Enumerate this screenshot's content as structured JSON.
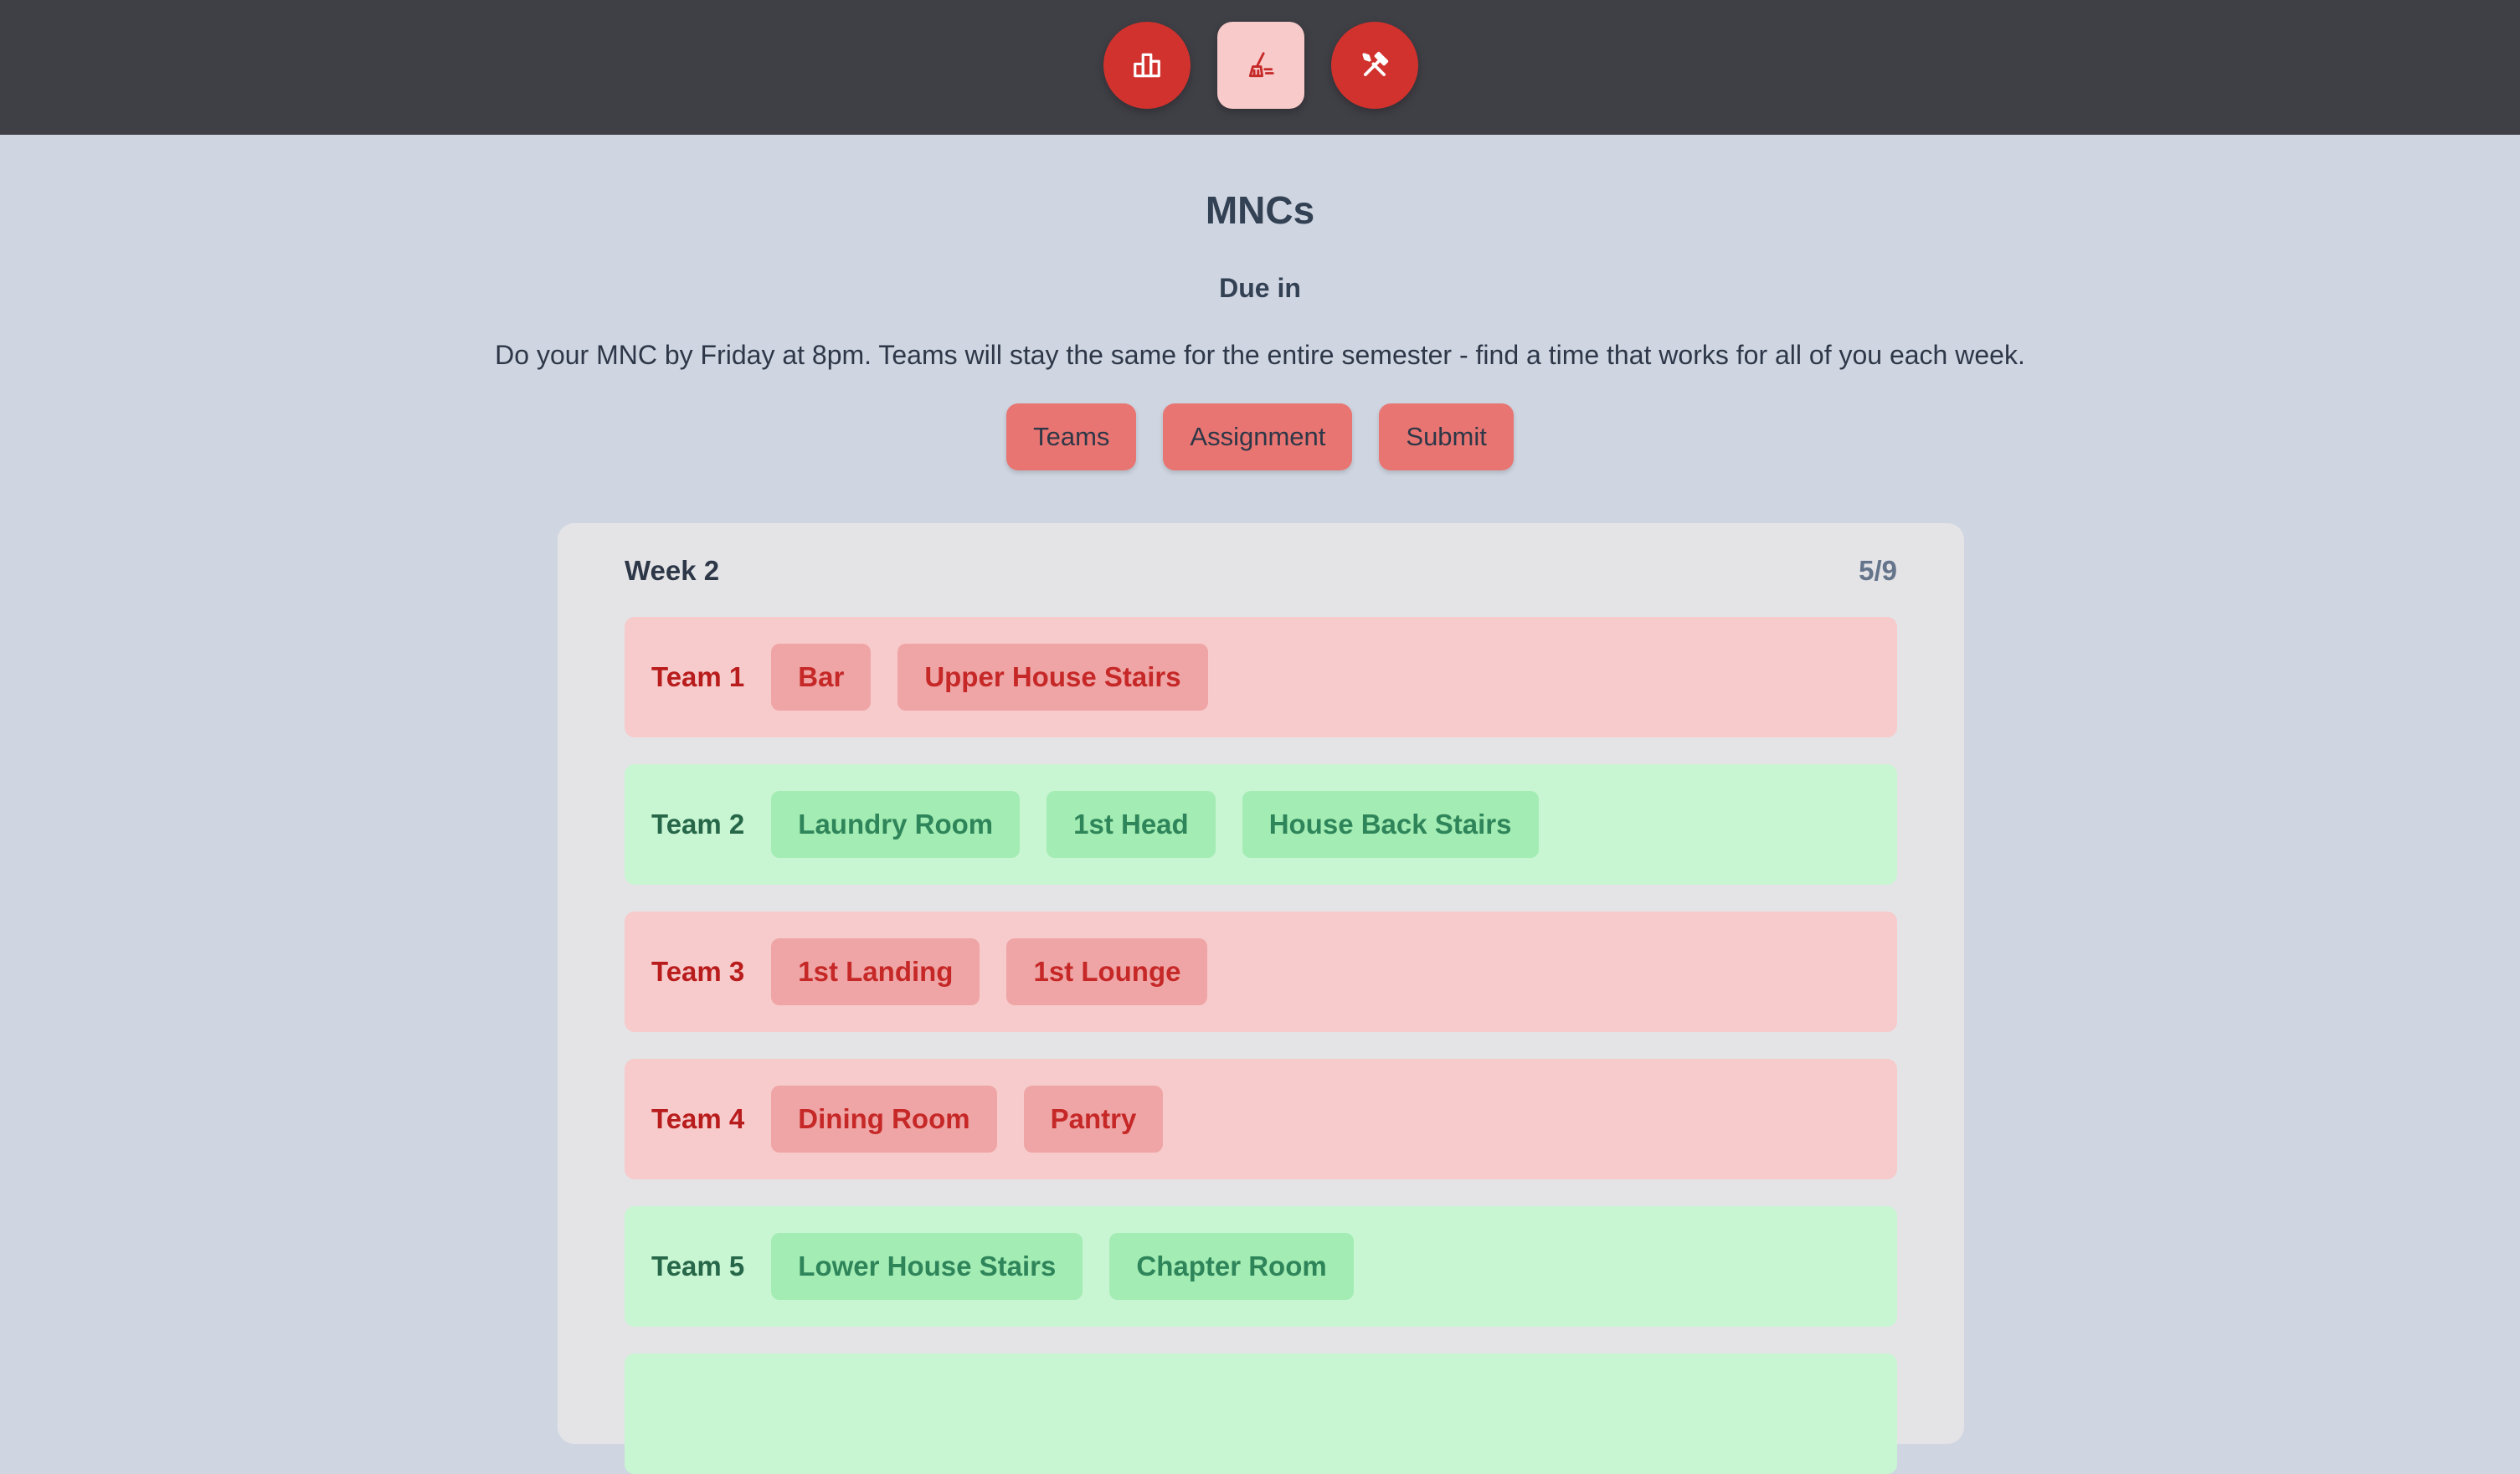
{
  "nav": {
    "items": [
      {
        "icon": "leaderboard-icon",
        "active": false
      },
      {
        "icon": "broom-icon",
        "active": true
      },
      {
        "icon": "tools-icon",
        "active": false
      }
    ],
    "colors": {
      "active_bg": "#f8caca",
      "inactive_bg": "#d2322d",
      "bar_bg": "#3f3f46"
    }
  },
  "page": {
    "title": "MNCs",
    "due_label": "Due in",
    "description": "Do your MNC by Friday at 8pm. Teams will stay the same for the entire semester - find a time that works for all of you each week."
  },
  "actions": {
    "teams": "Teams",
    "assignment": "Assignment",
    "submit": "Submit"
  },
  "week": {
    "label": "Week 2",
    "progress": "5/9",
    "teams": [
      {
        "name": "Team 1",
        "status": "pending",
        "chores": [
          "Bar",
          "Upper House Stairs"
        ]
      },
      {
        "name": "Team 2",
        "status": "done",
        "chores": [
          "Laundry Room",
          "1st Head",
          "House Back Stairs"
        ]
      },
      {
        "name": "Team 3",
        "status": "pending",
        "chores": [
          "1st Landing",
          "1st Lounge"
        ]
      },
      {
        "name": "Team 4",
        "status": "pending",
        "chores": [
          "Dining Room",
          "Pantry"
        ]
      },
      {
        "name": "Team 5",
        "status": "done",
        "chores": [
          "Lower House Stairs",
          "Chapter Room"
        ]
      },
      {
        "name": "",
        "status": "done",
        "chores": []
      }
    ]
  },
  "status_colors": {
    "pending": "#f7cbcb",
    "done": "#c8f5d2"
  }
}
